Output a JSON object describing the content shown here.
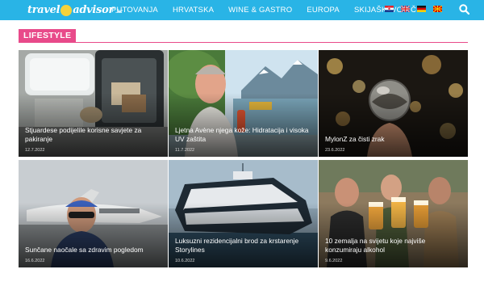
{
  "header": {
    "logo": {
      "part1": "travel",
      "part2": "advisor",
      "suffix": ".hr"
    },
    "nav": [
      "PUTOVANJA",
      "HRVATSKA",
      "WINE & GASTRO",
      "EUROPA",
      "SKIJAŠKI VODIČ"
    ],
    "languages": [
      "hr",
      "en",
      "de",
      "mk"
    ],
    "search_icon": "search-icon"
  },
  "section": {
    "label": "LIFESTYLE",
    "accent": "#e84a8a"
  },
  "articles": [
    {
      "title": "Stjuardese podijelile korisne savjete za pakiranje",
      "date": "12.7.2022"
    },
    {
      "title": "Ljetna Avène njega kože: Hidratacija i visoka UV zaštita",
      "date": "11.7.2022"
    },
    {
      "title": "MylonZ za čisti zrak",
      "date": "23.6.2022"
    },
    {
      "title": "Sunčane naočale sa zdravim pogledom",
      "date": "16.6.2022"
    },
    {
      "title": "Luksuzni rezidencijalni brod za krstarenje Storylines",
      "date": "10.6.2022"
    },
    {
      "title": "10 zemalja na svijetu koje najviše konzumiraju alkohol",
      "date": "9.6.2022"
    }
  ],
  "colors": {
    "header": "#29b4e6",
    "logo_accent": "#f5d23a"
  }
}
